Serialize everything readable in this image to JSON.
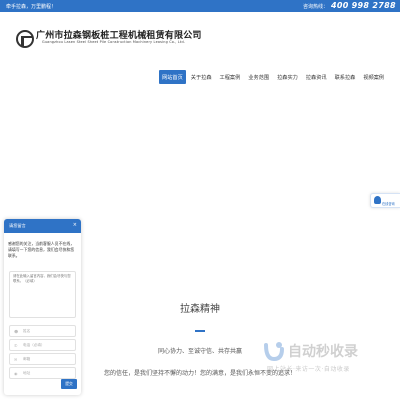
{
  "topbar": {
    "welcome": "牵手拉森，万里鹏程！",
    "hotline_label": "咨询热线：",
    "phone": "400 998 2788"
  },
  "header": {
    "company_cn": "广州市拉森钢板桩工程机械租赁有限公司",
    "company_en": "Guangzhou Lasen Steel Sheet Pile Construction Machinery Leasing Co., Ltd."
  },
  "nav": [
    {
      "label": "网站首页",
      "active": true
    },
    {
      "label": "关于拉森"
    },
    {
      "label": "工程案例"
    },
    {
      "label": "业务范围"
    },
    {
      "label": "拉森实力"
    },
    {
      "label": "拉森资讯"
    },
    {
      "label": "联系拉森"
    },
    {
      "label": "视频案例"
    }
  ],
  "cs_float": {
    "label": "在线咨询"
  },
  "chat": {
    "title": "请您留言",
    "close": "×",
    "greeting": "感谢您的关注，当前客服人员不在线，请填写一下您的信息，我们会尽快和您联系。",
    "message_placeholder": "请在此输入留言内容，我们会尽快与您联系。（必填）",
    "fields": [
      {
        "icon": "user-icon",
        "placeholder": "姓名"
      },
      {
        "icon": "phone-icon",
        "placeholder": "电话（必填）"
      },
      {
        "icon": "email-icon",
        "placeholder": "邮箱"
      },
      {
        "icon": "location-icon",
        "placeholder": "地址"
      }
    ],
    "submit": "提交"
  },
  "main": {
    "section_title": "拉森精神",
    "motto": "同心协力、至诚守信、共存共赢",
    "tagline": "您的信任，是我们坚持不懈的动力！您的满意，是我们永恒不变的追求！"
  },
  "watermark": {
    "text": "自动秒收录",
    "sub": "网上站长·来访一次·自动收录"
  }
}
